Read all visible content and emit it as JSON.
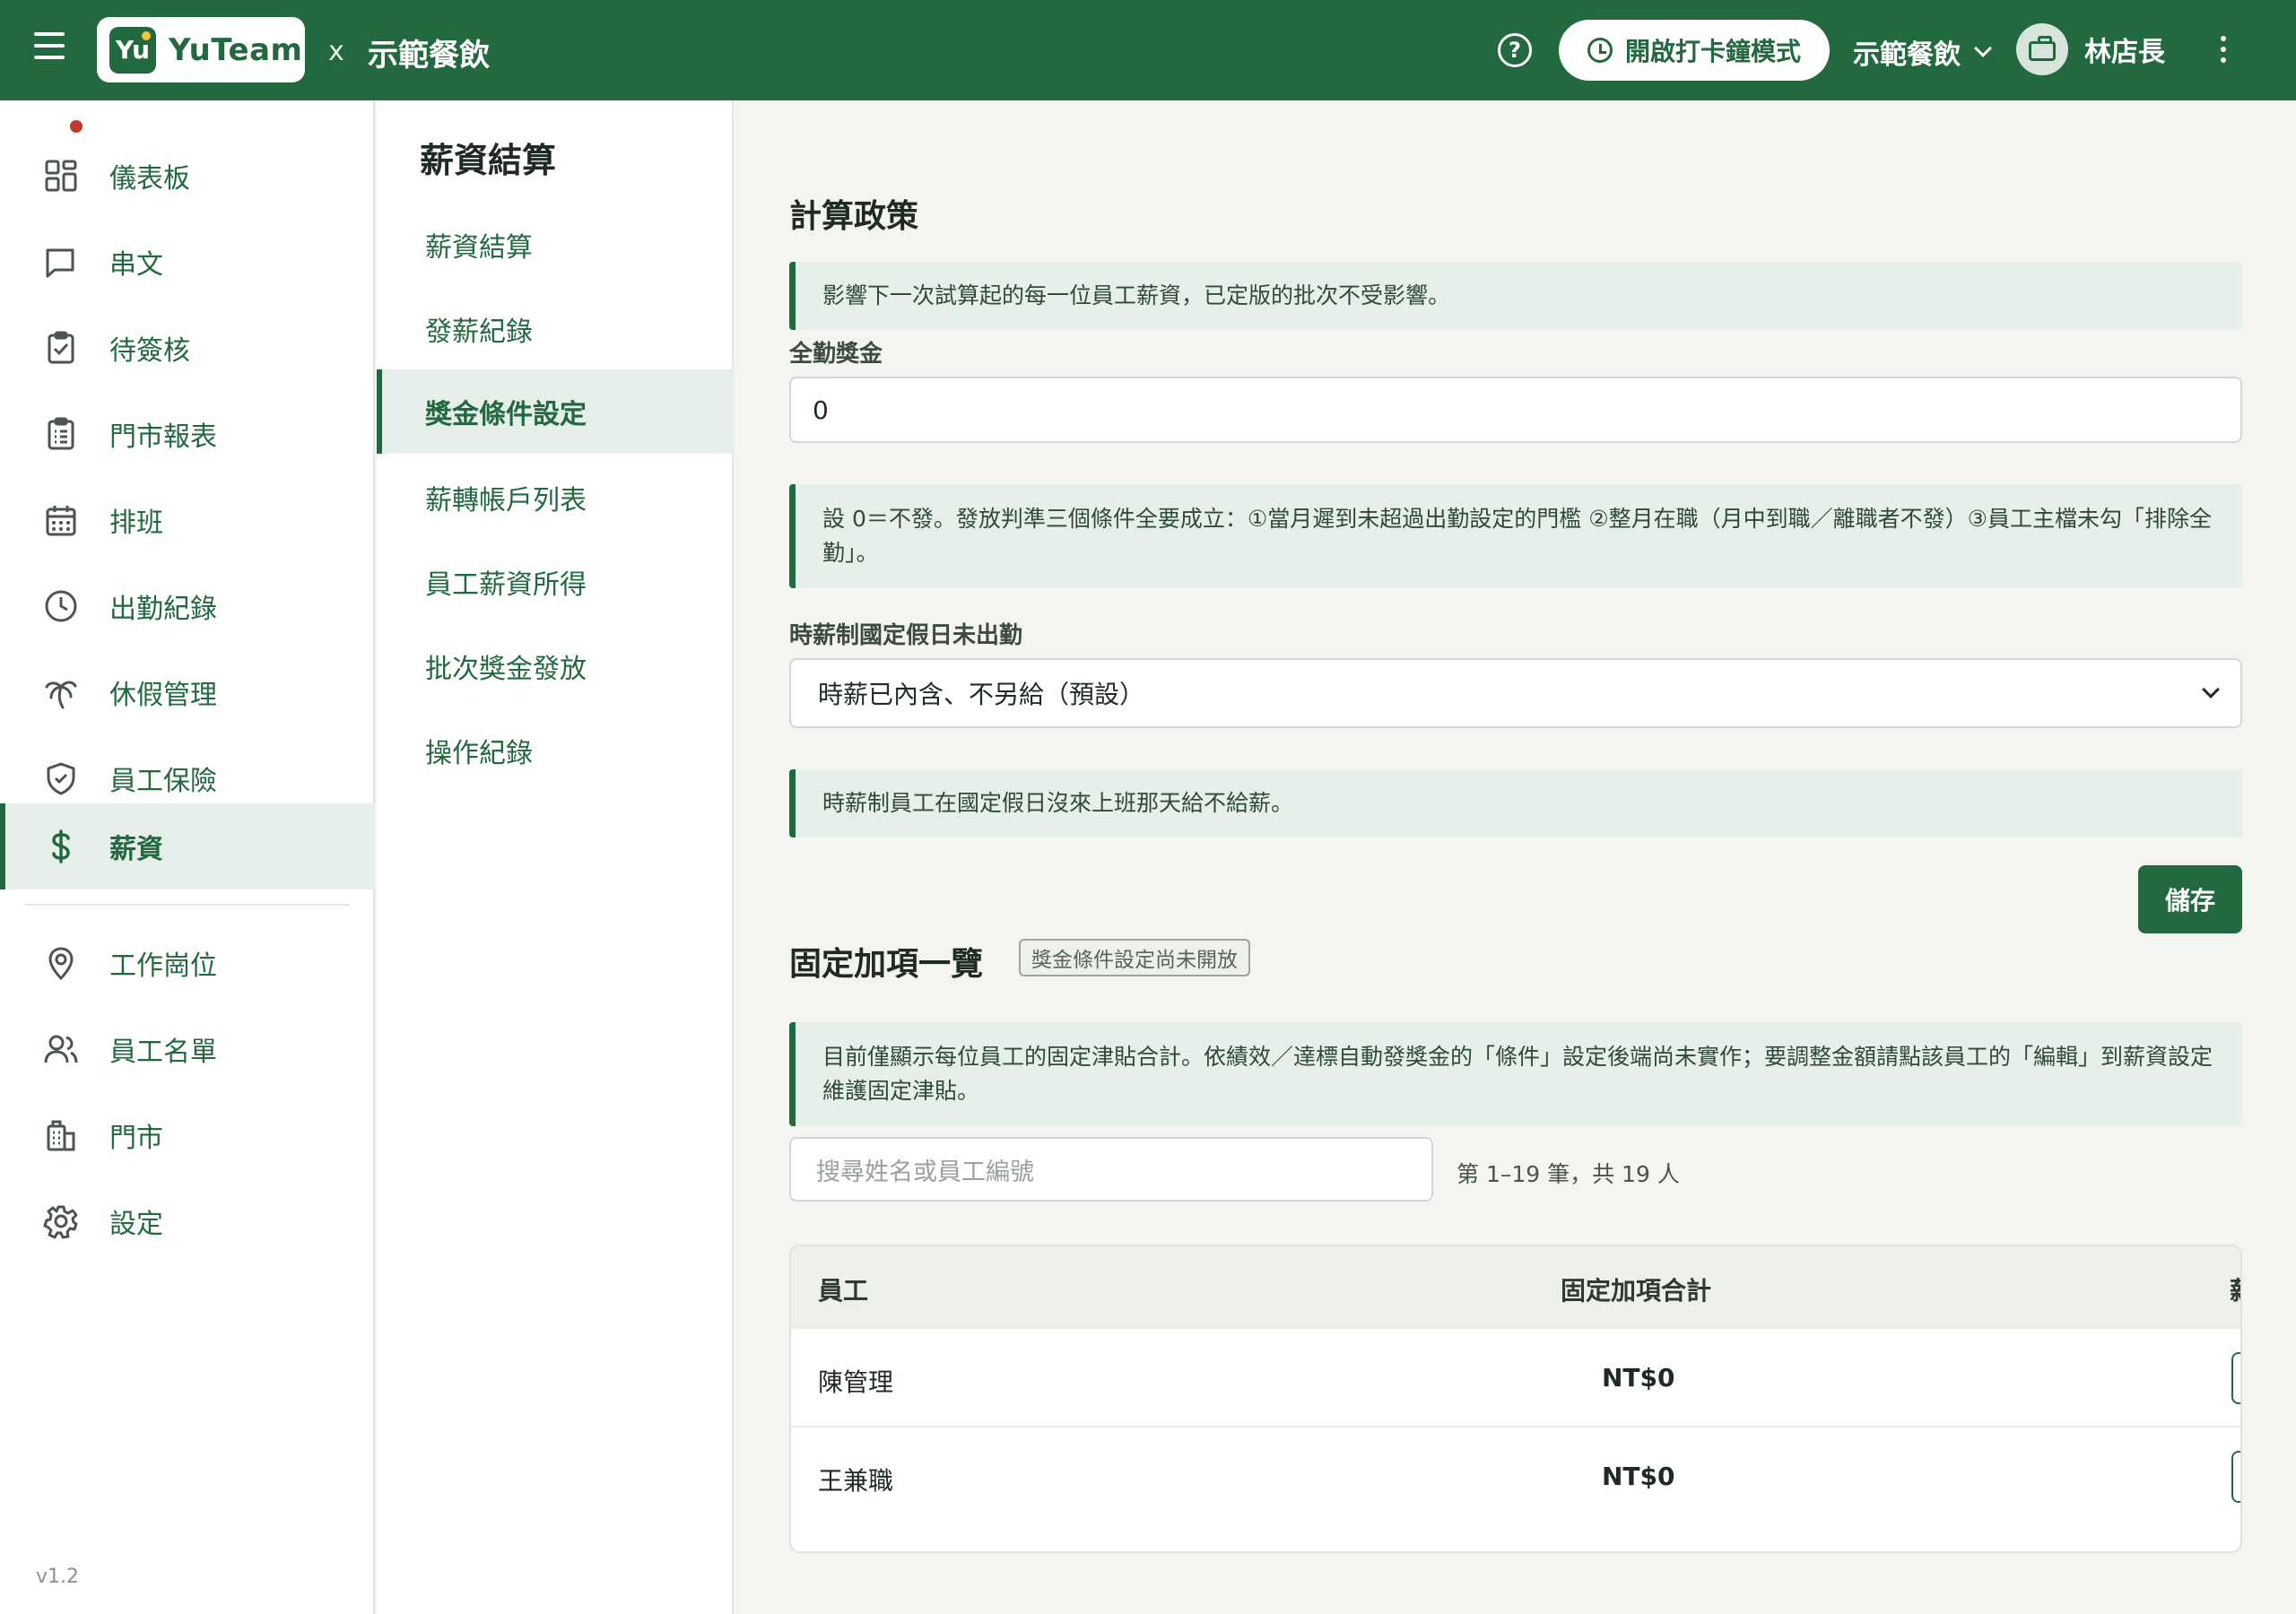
{
  "app": {
    "logo_mark": "Yu",
    "logo_text": "YuTeam",
    "separator": "x",
    "org_name": "示範餐飲",
    "clock_mode_label": "開啟打卡鐘模式",
    "store_selected": "示範餐飲",
    "user_name": "林店長",
    "version": "v1.2"
  },
  "sidebar": {
    "items": [
      {
        "label": "儀表板",
        "icon": "dashboard-icon"
      },
      {
        "label": "串文",
        "icon": "chat-icon"
      },
      {
        "label": "待簽核",
        "icon": "clipboard-check-icon"
      },
      {
        "label": "門市報表",
        "icon": "report-icon"
      },
      {
        "label": "排班",
        "icon": "calendar-icon"
      },
      {
        "label": "出勤紀錄",
        "icon": "clock-icon"
      },
      {
        "label": "休假管理",
        "icon": "palm-tree-icon"
      },
      {
        "label": "員工保險",
        "icon": "shield-icon"
      },
      {
        "label": "薪資",
        "icon": "dollar-icon"
      },
      {
        "label": "工作崗位",
        "icon": "location-pin-icon"
      },
      {
        "label": "員工名單",
        "icon": "users-icon"
      },
      {
        "label": "門市",
        "icon": "building-icon"
      },
      {
        "label": "設定",
        "icon": "gear-icon"
      }
    ]
  },
  "subnav": {
    "title": "薪資結算",
    "items": [
      {
        "label": "薪資結算"
      },
      {
        "label": "發薪紀錄"
      },
      {
        "label": "獎金條件設定"
      },
      {
        "label": "薪轉帳戶列表"
      },
      {
        "label": "員工薪資所得"
      },
      {
        "label": "批次獎金發放"
      },
      {
        "label": "操作紀錄"
      }
    ]
  },
  "policy": {
    "title": "計算政策",
    "notice": "影響下一次試算起的每一位員工薪資，已定版的批次不受影響。",
    "attendance_bonus_label": "全勤獎金",
    "attendance_bonus_value": "0",
    "attendance_notice": "設 0＝不發。發放判準三個條件全要成立：①當月遲到未超過出勤設定的門檻 ②整月在職（月中到職／離職者不發）③員工主檔未勾「排除全勤」。",
    "holiday_label": "時薪制國定假日未出勤",
    "holiday_selected": "時薪已內含、不另給（預設）",
    "holiday_notice": "時薪制員工在國定假日沒來上班那天給不給薪。",
    "save_label": "儲存"
  },
  "fixed": {
    "title": "固定加項一覽",
    "tag": "獎金條件設定尚未開放",
    "notice": "目前僅顯示每位員工的固定津貼合計。依績效／達標自動發獎金的「條件」設定後端尚未實作；要調整金額請點該員工的「編輯」到薪資設定維護固定津貼。",
    "search_placeholder": "搜尋姓名或員工編號",
    "count_text": "第 1–19 筆，共 19 人",
    "columns": [
      "員工",
      "固定加項合計",
      "薪"
    ],
    "rows": [
      {
        "name": "陳管理",
        "amount": "NT$0"
      },
      {
        "name": "王兼職",
        "amount": "NT$0"
      }
    ]
  },
  "colors": {
    "primary": "#23693f",
    "primary_light": "#e6efe9",
    "background": "#f4f4f0",
    "badge": "#c0392b"
  }
}
